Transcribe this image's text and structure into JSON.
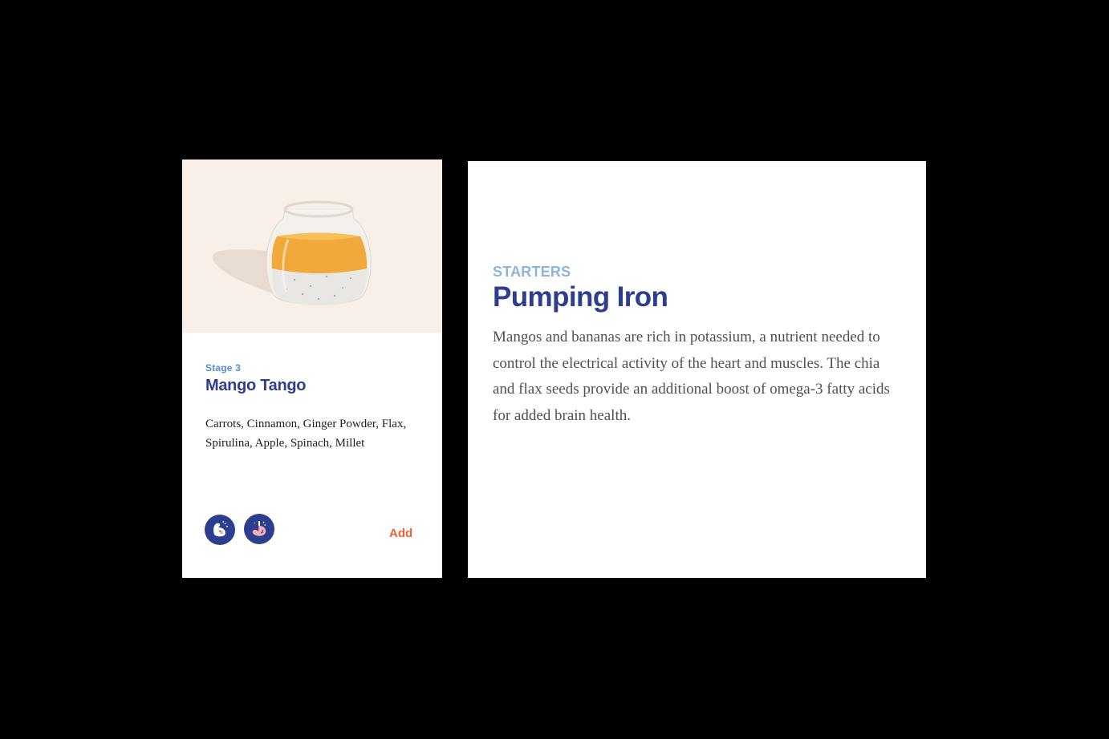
{
  "product_card": {
    "stage": "Stage 3",
    "title": "Mango Tango",
    "ingredients": "Carrots, Cinnamon, Ginger Powder, Flax, Spirulina, Apple, Spinach, Millet",
    "badges": [
      "muscle-icon",
      "belly-icon"
    ],
    "add_label": "Add"
  },
  "info_panel": {
    "category": "STARTERS",
    "title": "Pumping Iron",
    "description": "Mangos and bananas are rich in potassium, a nutrient needed to control the electrical activity of the heart and muscles. The chia and flax seeds provide an additional boost of omega-3 fatty acids for added brain health."
  },
  "colors": {
    "background": "#000000",
    "navy": "#2e3e8f",
    "stage_blue": "#5b8bd0",
    "category_blue": "#8cb4dc",
    "add_orange": "#ec6436",
    "image_bg": "#f8efe8"
  }
}
